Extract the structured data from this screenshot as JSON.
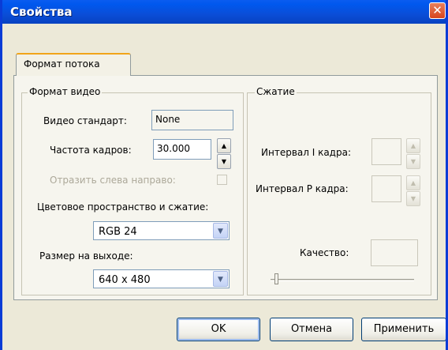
{
  "window": {
    "title": "Свойства",
    "close_glyph": "✕"
  },
  "tabs": [
    {
      "label": "Формат потока"
    }
  ],
  "video_format": {
    "title": "Формат видео",
    "standard_label": "Видео стандарт:",
    "standard_value": "None",
    "framerate_label": "Частота кадров:",
    "framerate_value": "30.000",
    "flip_label": "Отразить слева направо:",
    "colorspace_label": "Цветовое пространство и сжатие:",
    "colorspace_value": "RGB 24",
    "output_size_label": "Размер на выходе:",
    "output_size_value": "640 x 480"
  },
  "compression": {
    "title": "Сжатие",
    "i_frame_label": "Интервал I кадра:",
    "p_frame_label": "Интервал P кадра:",
    "quality_label": "Качество:",
    "quality_level": 0.0
  },
  "buttons": {
    "ok": "OK",
    "cancel": "Отмена",
    "apply": "Применить"
  },
  "glyphs": {
    "up": "▲",
    "down": "▼"
  },
  "colors": {
    "title_bar": "#0a4ed8",
    "close_button": "#d8451d",
    "tab_highlight": "#f1a41a"
  }
}
